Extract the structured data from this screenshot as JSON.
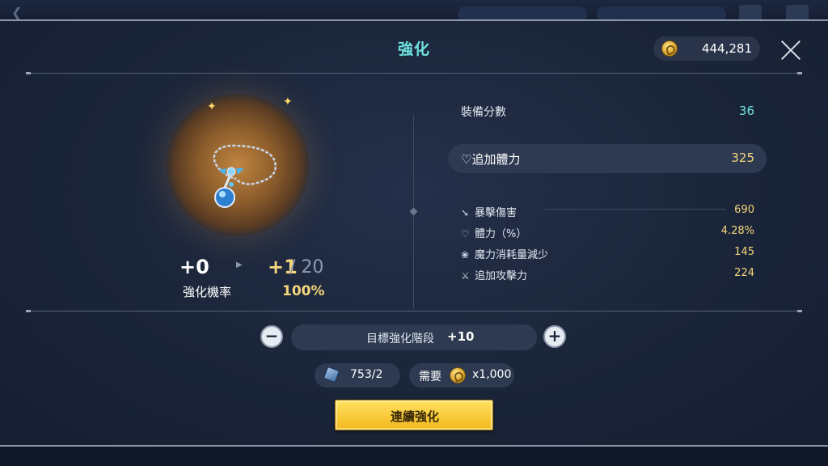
{
  "dialog": {
    "title": "強化",
    "currency_amount": "444,281",
    "close_icon": "close-icon"
  },
  "item": {
    "current_level": "+0",
    "next_level": "+1",
    "max_level": "/ 20",
    "success_rate_label": "強化機率",
    "success_rate_value": "100%"
  },
  "stats": {
    "score_label": "裝備分數",
    "score_value": "36",
    "main_label": "追加體力",
    "main_value": "325",
    "sub": [
      {
        "label": "暴擊傷害",
        "value": "690",
        "icon": "crit-damage-icon"
      },
      {
        "label": "體力（%）",
        "value": "4.28%",
        "icon": "heart-icon"
      },
      {
        "label": "魔力消耗量減少",
        "value": "145",
        "icon": "mana-icon"
      },
      {
        "label": "追加攻擊力",
        "value": "224",
        "icon": "sword-icon"
      }
    ]
  },
  "target": {
    "label": "目標強化階段",
    "value": "+10",
    "minus": "−",
    "plus": "+"
  },
  "materials": {
    "stones": "753/2",
    "cost_label": "需要",
    "cost_value": "x1,000"
  },
  "confirm_label": "連續強化"
}
